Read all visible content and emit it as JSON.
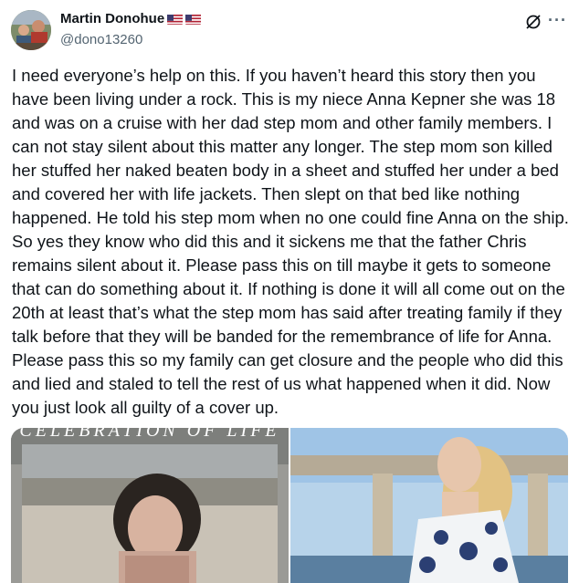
{
  "author": {
    "name": "Martin Donohue",
    "handle": "@dono13260",
    "flags": [
      "us-flag-icon",
      "us-flag-icon"
    ]
  },
  "actions": {
    "grok_icon": "grok-icon",
    "more_icon": "more-icon"
  },
  "tweet": {
    "text": "I need everyone’s help on this. If you haven’t heard this story then you have been living under a rock. This is my niece Anna Kepner she was 18 and was on a cruise with her dad step mom and other family members. I can not stay silent about this matter any longer. The step mom son killed her stuffed her naked beaten body in a sheet and stuffed her under a bed and covered her with life jackets. Then slept on that bed like nothing happened. He told his step mom when no one could fine Anna on the ship. So yes they know who did this and it sickens me that the father Chris remains silent about it. Please pass this on till maybe it gets to someone that can do something about it. If nothing is done it will all come out on the 20th at least that’s what the step mom has said after treating family if they talk before that they will be banded for the remembrance of life for Anna. Please pass this so my family can get closure and the people who did this and lied and staled to tell the rest of us what happened when it did. Now you just look all guilty of a cover up."
  },
  "media": {
    "left_caption": "CELEBRATION OF LIFE"
  },
  "colors": {
    "text": "#0f1419",
    "secondary": "#536471"
  }
}
